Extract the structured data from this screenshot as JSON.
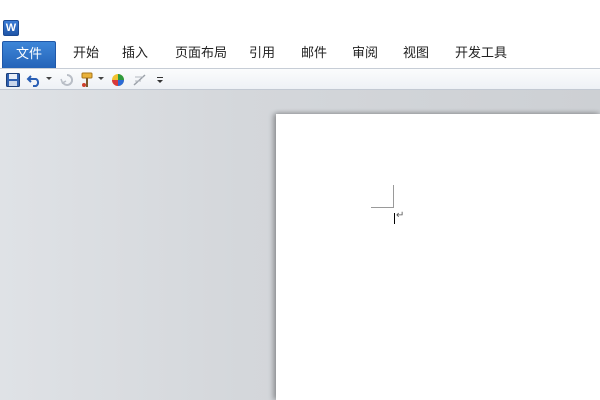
{
  "app": {
    "icon_letter": "W"
  },
  "ribbon": {
    "file_tab": "文件",
    "tabs": [
      {
        "id": "home",
        "label": "开始"
      },
      {
        "id": "insert",
        "label": "插入"
      },
      {
        "id": "page-layout",
        "label": "页面布局"
      },
      {
        "id": "references",
        "label": "引用"
      },
      {
        "id": "mailings",
        "label": "邮件"
      },
      {
        "id": "review",
        "label": "审阅"
      },
      {
        "id": "view",
        "label": "视图"
      },
      {
        "id": "developer",
        "label": "开发工具"
      }
    ]
  },
  "quick_access": {
    "buttons": [
      {
        "icon": "save-icon"
      },
      {
        "icon": "undo-icon"
      },
      {
        "icon": "redo-icon"
      },
      {
        "icon": "format-painter-icon"
      },
      {
        "icon": "color-icon"
      },
      {
        "icon": "drawing-icon"
      },
      {
        "icon": "customize-icon"
      }
    ]
  },
  "document": {
    "paragraph_mark": "↵"
  },
  "colors": {
    "accent": "#2b6cc4",
    "workspace": "#d4d7db",
    "page": "#ffffff"
  }
}
